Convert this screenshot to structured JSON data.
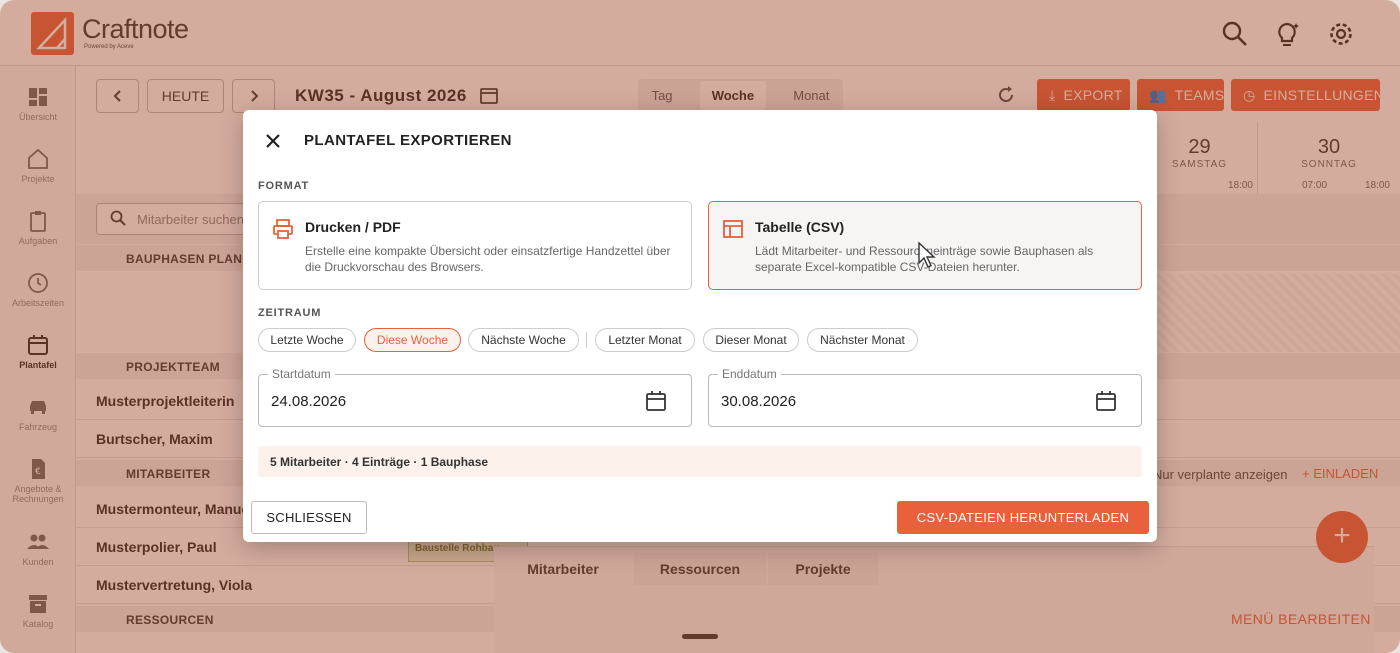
{
  "app": {
    "name": "Craftnote",
    "powered_by": "Powered by Aceve"
  },
  "sidebar": {
    "items": [
      {
        "label": "Übersicht"
      },
      {
        "label": "Projekte"
      },
      {
        "label": "Aufgaben"
      },
      {
        "label": "Arbeitszeiten"
      },
      {
        "label": "Plantafel",
        "active": true
      },
      {
        "label": "Fahrzeug"
      },
      {
        "label": "Angebote & Rechnungen"
      },
      {
        "label": "Kunden"
      },
      {
        "label": "Katalog"
      }
    ]
  },
  "toolbar": {
    "today_label": "HEUTE",
    "week_title": "KW35 - August 2026",
    "views": [
      "Tag",
      "Woche",
      "Monat"
    ],
    "active_view": "Woche",
    "export_label": "EXPORT",
    "teams_label": "TEAMS",
    "settings_label": "EINSTELLUNGEN"
  },
  "days": [
    {
      "date": "29",
      "name": "SAMSTAG",
      "start": "",
      "end": "18:00"
    },
    {
      "date": "30",
      "name": "SONNTAG",
      "start": "07:00",
      "end": "18:00"
    }
  ],
  "planner": {
    "search_placeholder": "Mitarbeiter suchen",
    "sections": {
      "bauphasen": "BAUPHASEN PLANEN",
      "projektteam": "PROJEKTTEAM",
      "mitarbeiter": "MITARBEITER",
      "ressourcen": "RESSOURCEN"
    },
    "rows": {
      "r1": "Musterprojektleiterin",
      "r2": "Burtscher, Maxim",
      "r3": "Mustermonteur, Manuel",
      "r4": "Musterpolier, Paul",
      "r5": "Mustervertretung, Viola"
    },
    "event_label": "Baustelle Rohbau",
    "show_unplanned": "Nur verplante anzeigen",
    "invite_label": "+ EINLADEN",
    "edit_menu": "MENÜ BEARBEITEN",
    "bottom_tabs": [
      "Mitarbeiter",
      "Ressourcen",
      "Projekte"
    ]
  },
  "modal": {
    "title": "PLANTAFEL EXPORTIEREN",
    "format_caption": "FORMAT",
    "formats": [
      {
        "title": "Drucken / PDF",
        "desc": "Erstelle eine kompakte Übersicht oder einsatzfertige Handzettel über die Druckvorschau des Browsers.",
        "selected": false
      },
      {
        "title": "Tabelle (CSV)",
        "desc": "Lädt Mitarbeiter- und Ressourceneinträge sowie Bauphasen als separate Excel-kompatible CSV-Dateien herunter.",
        "selected": true
      }
    ],
    "range_caption": "ZEITRAUM",
    "ranges": [
      "Letzte Woche",
      "Diese Woche",
      "Nächste Woche",
      "Letzter Monat",
      "Dieser Monat",
      "Nächster Monat"
    ],
    "active_range": "Diese Woche",
    "start_label": "Startdatum",
    "start_value": "24.08.2026",
    "end_label": "Enddatum",
    "end_value": "30.08.2026",
    "summary": "5 Mitarbeiter · 4 Einträge · 1 Bauphase",
    "close_label": "SCHLIESSEN",
    "download_label": "CSV-DATEIEN HERUNTERLADEN"
  },
  "colors": {
    "accent": "#e8603c",
    "accent_soft": "#fdf1ec"
  }
}
